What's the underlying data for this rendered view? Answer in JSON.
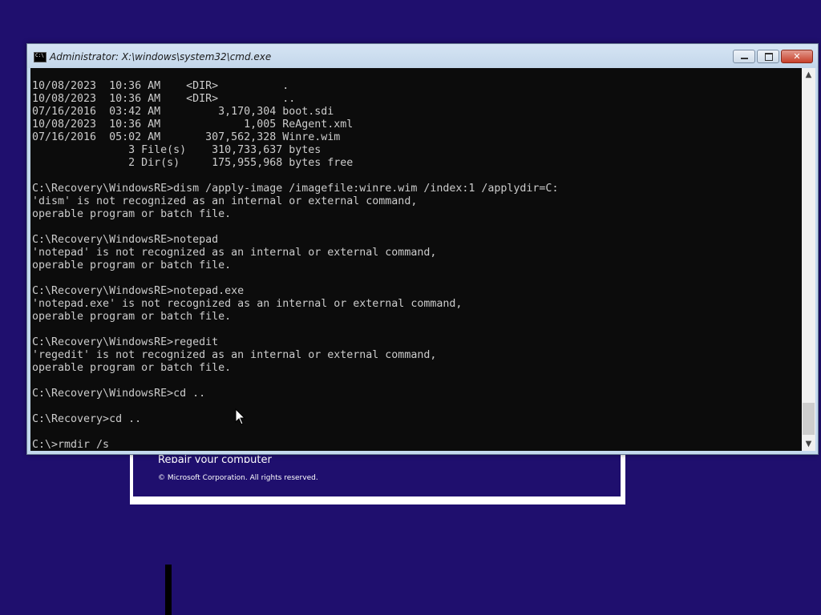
{
  "window": {
    "title": "Administrator: X:\\windows\\system32\\cmd.exe",
    "minimize_icon": "minimize-icon",
    "maximize_icon": "maximize-icon",
    "close_glyph": "✕"
  },
  "console": {
    "lines": [
      "10/08/2023  10:36 AM    <DIR>          .",
      "10/08/2023  10:36 AM    <DIR>          ..",
      "07/16/2016  03:42 AM         3,170,304 boot.sdi",
      "10/08/2023  10:36 AM             1,005 ReAgent.xml",
      "07/16/2016  05:02 AM       307,562,328 Winre.wim",
      "               3 File(s)    310,733,637 bytes",
      "               2 Dir(s)     175,955,968 bytes free",
      "",
      "C:\\Recovery\\WindowsRE>dism /apply-image /imagefile:winre.wim /index:1 /applydir=C:",
      "'dism' is not recognized as an internal or external command,",
      "operable program or batch file.",
      "",
      "C:\\Recovery\\WindowsRE>notepad",
      "'notepad' is not recognized as an internal or external command,",
      "operable program or batch file.",
      "",
      "C:\\Recovery\\WindowsRE>notepad.exe",
      "'notepad.exe' is not recognized as an internal or external command,",
      "operable program or batch file.",
      "",
      "C:\\Recovery\\WindowsRE>regedit",
      "'regedit' is not recognized as an internal or external command,",
      "operable program or batch file.",
      "",
      "C:\\Recovery\\WindowsRE>cd ..",
      "",
      "C:\\Recovery>cd ..",
      "",
      "C:\\>rmdir /s"
    ]
  },
  "scrollbar": {
    "up_glyph": "▲",
    "down_glyph": "▼"
  },
  "setup_background": {
    "repair_first_letter": "R",
    "repair_rest": "epair your computer",
    "copyright": "© Microsoft Corporation. All rights reserved."
  },
  "colors": {
    "desktop": "#1f0f6e",
    "console_bg": "#0c0c0c",
    "console_text": "#cccccc",
    "close_button": "#c7402a"
  }
}
